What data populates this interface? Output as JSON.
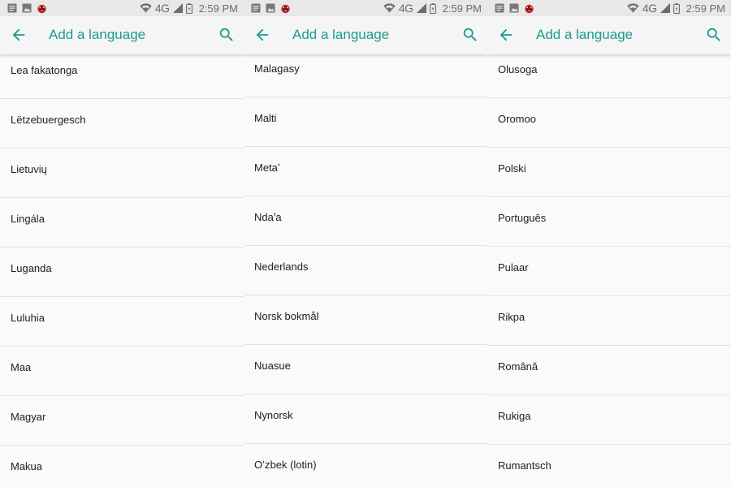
{
  "screens": [
    {
      "status": {
        "network": "4G",
        "time": "2:59 PM"
      },
      "title": "Add a language",
      "languages": [
        "Lea fakatonga",
        "Lëtzebuergesch",
        "Lietuvių",
        "Lingála",
        "Luganda",
        "Luluhia",
        "Maa",
        "Magyar",
        "Makua"
      ]
    },
    {
      "status": {
        "network": "4G",
        "time": "2:59 PM"
      },
      "title": "Add a language",
      "languages": [
        "Malagasy",
        "Malti",
        "Metaʼ",
        "Ndaꞌa",
        "Nederlands",
        "Norsk bokmål",
        "Nuasue",
        "Nynorsk",
        "Oʻzbek (lotin)"
      ]
    },
    {
      "status": {
        "network": "4G",
        "time": "2:59 PM"
      },
      "title": "Add a language",
      "languages": [
        "Olusoga",
        "Oromoo",
        "Polski",
        "Português",
        "Pulaar",
        "Rikpa",
        "Română",
        "Rukiga",
        "Rumantsch"
      ]
    }
  ],
  "icons": {
    "notification_1": "notification-icon",
    "notification_2": "image-icon",
    "notification_3": "bug-icon",
    "wifi": "wifi-icon",
    "signal": "cell-signal-icon",
    "battery": "battery-icon",
    "back": "arrow-back-icon",
    "search": "search-icon"
  },
  "colors": {
    "accent": "#1a9b8e",
    "status_bar": "#e8e8e8",
    "app_bar": "#f5f5f5",
    "background": "#fafafa",
    "divider": "#e3e3e3",
    "text": "#212121"
  }
}
